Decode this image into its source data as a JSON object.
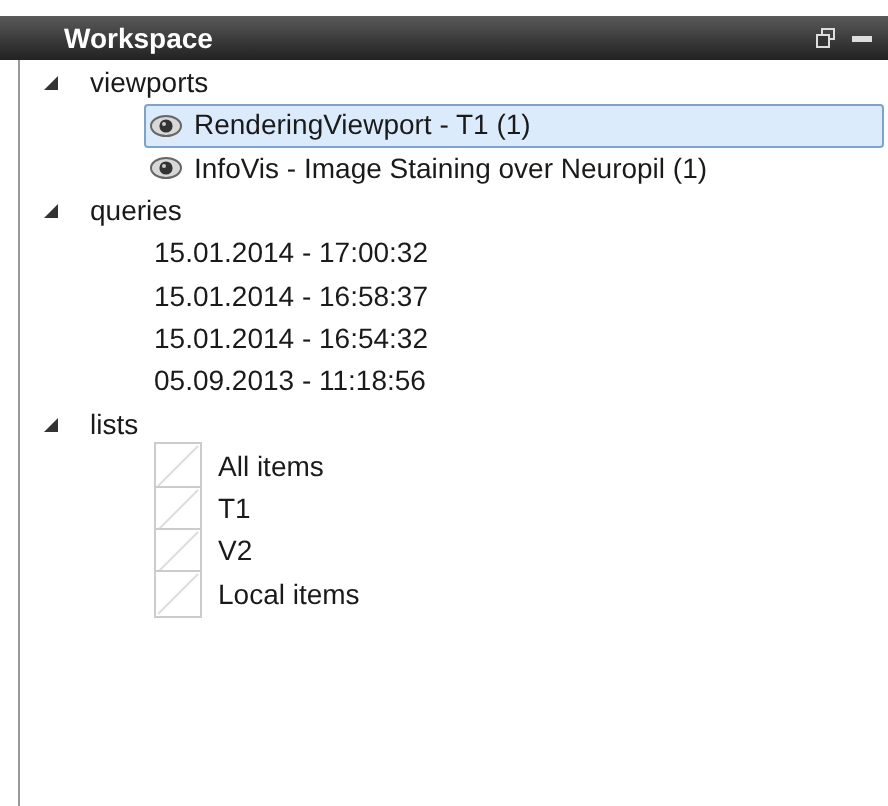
{
  "panel": {
    "title": "Workspace"
  },
  "tree": [
    {
      "label": "viewports",
      "expanded": true,
      "children": [
        {
          "label": "RenderingViewport - T1 (1)",
          "kind": "eye",
          "selected": true
        },
        {
          "label": "InfoVis - Image Staining over Neuropil (1)",
          "kind": "eye",
          "selected": false
        }
      ]
    },
    {
      "label": "queries",
      "expanded": true,
      "children": [
        {
          "label": "15.01.2014 - 17:00:32",
          "kind": "plain",
          "selected": false
        },
        {
          "label": "15.01.2014 - 16:58:37",
          "kind": "plain",
          "selected": false
        },
        {
          "label": "15.01.2014 - 16:54:32",
          "kind": "plain",
          "selected": false
        },
        {
          "label": "05.09.2013 - 11:18:56",
          "kind": "plain",
          "selected": false
        }
      ]
    },
    {
      "label": "lists",
      "expanded": true,
      "children": [
        {
          "label": "All items",
          "kind": "blank",
          "selected": false
        },
        {
          "label": "T1",
          "kind": "blank",
          "selected": false
        },
        {
          "label": "V2",
          "kind": "blank",
          "selected": false
        },
        {
          "label": "Local items",
          "kind": "blank",
          "selected": false
        }
      ]
    }
  ]
}
